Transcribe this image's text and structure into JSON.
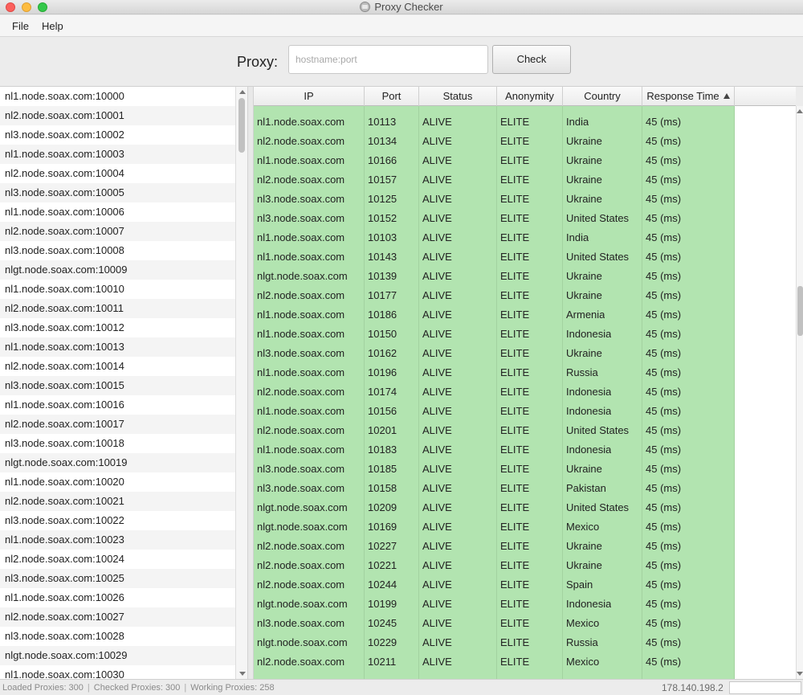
{
  "window": {
    "title": "Proxy Checker"
  },
  "menu": {
    "file": "File",
    "help": "Help"
  },
  "proxy_bar": {
    "label": "Proxy:",
    "placeholder": "hostname:port",
    "check_label": "Check"
  },
  "proxy_list": [
    "nl1.node.soax.com:10000",
    "nl2.node.soax.com:10001",
    "nl3.node.soax.com:10002",
    "nl1.node.soax.com:10003",
    "nl2.node.soax.com:10004",
    "nl3.node.soax.com:10005",
    "nl1.node.soax.com:10006",
    "nl2.node.soax.com:10007",
    "nl3.node.soax.com:10008",
    "nlgt.node.soax.com:10009",
    "nl1.node.soax.com:10010",
    "nl2.node.soax.com:10011",
    "nl3.node.soax.com:10012",
    "nl1.node.soax.com:10013",
    "nl2.node.soax.com:10014",
    "nl3.node.soax.com:10015",
    "nl1.node.soax.com:10016",
    "nl2.node.soax.com:10017",
    "nl3.node.soax.com:10018",
    "nlgt.node.soax.com:10019",
    "nl1.node.soax.com:10020",
    "nl2.node.soax.com:10021",
    "nl3.node.soax.com:10022",
    "nl1.node.soax.com:10023",
    "nl2.node.soax.com:10024",
    "nl3.node.soax.com:10025",
    "nl1.node.soax.com:10026",
    "nl2.node.soax.com:10027",
    "nl3.node.soax.com:10028",
    "nlgt.node.soax.com:10029",
    "nl1.node.soax.com:10030"
  ],
  "table": {
    "columns": [
      "IP",
      "Port",
      "Status",
      "Anonymity",
      "Country",
      "Response Time"
    ],
    "sorted_column": "Response Time",
    "row_color": "#b2e4b0",
    "rows": [
      [
        "nl1.node.soax.com",
        "10113",
        "ALIVE",
        "ELITE",
        "India",
        "45 (ms)"
      ],
      [
        "nl2.node.soax.com",
        "10134",
        "ALIVE",
        "ELITE",
        "Ukraine",
        "45 (ms)"
      ],
      [
        "nl1.node.soax.com",
        "10166",
        "ALIVE",
        "ELITE",
        "Ukraine",
        "45 (ms)"
      ],
      [
        "nl2.node.soax.com",
        "10157",
        "ALIVE",
        "ELITE",
        "Ukraine",
        "45 (ms)"
      ],
      [
        "nl3.node.soax.com",
        "10125",
        "ALIVE",
        "ELITE",
        "Ukraine",
        "45 (ms)"
      ],
      [
        "nl3.node.soax.com",
        "10152",
        "ALIVE",
        "ELITE",
        "United States",
        "45 (ms)"
      ],
      [
        "nl1.node.soax.com",
        "10103",
        "ALIVE",
        "ELITE",
        "India",
        "45 (ms)"
      ],
      [
        "nl1.node.soax.com",
        "10143",
        "ALIVE",
        "ELITE",
        "United States",
        "45 (ms)"
      ],
      [
        "nlgt.node.soax.com",
        "10139",
        "ALIVE",
        "ELITE",
        "Ukraine",
        "45 (ms)"
      ],
      [
        "nl2.node.soax.com",
        "10177",
        "ALIVE",
        "ELITE",
        "Ukraine",
        "45 (ms)"
      ],
      [
        "nl1.node.soax.com",
        "10186",
        "ALIVE",
        "ELITE",
        "Armenia",
        "45 (ms)"
      ],
      [
        "nl1.node.soax.com",
        "10150",
        "ALIVE",
        "ELITE",
        "Indonesia",
        "45 (ms)"
      ],
      [
        "nl3.node.soax.com",
        "10162",
        "ALIVE",
        "ELITE",
        "Ukraine",
        "45 (ms)"
      ],
      [
        "nl1.node.soax.com",
        "10196",
        "ALIVE",
        "ELITE",
        "Russia",
        "45 (ms)"
      ],
      [
        "nl2.node.soax.com",
        "10174",
        "ALIVE",
        "ELITE",
        "Indonesia",
        "45 (ms)"
      ],
      [
        "nl1.node.soax.com",
        "10156",
        "ALIVE",
        "ELITE",
        "Indonesia",
        "45 (ms)"
      ],
      [
        "nl2.node.soax.com",
        "10201",
        "ALIVE",
        "ELITE",
        "United States",
        "45 (ms)"
      ],
      [
        "nl1.node.soax.com",
        "10183",
        "ALIVE",
        "ELITE",
        "Indonesia",
        "45 (ms)"
      ],
      [
        "nl3.node.soax.com",
        "10185",
        "ALIVE",
        "ELITE",
        "Ukraine",
        "45 (ms)"
      ],
      [
        "nl3.node.soax.com",
        "10158",
        "ALIVE",
        "ELITE",
        "Pakistan",
        "45 (ms)"
      ],
      [
        "nlgt.node.soax.com",
        "10209",
        "ALIVE",
        "ELITE",
        "United States",
        "45 (ms)"
      ],
      [
        "nlgt.node.soax.com",
        "10169",
        "ALIVE",
        "ELITE",
        "Mexico",
        "45 (ms)"
      ],
      [
        "nl2.node.soax.com",
        "10227",
        "ALIVE",
        "ELITE",
        "Ukraine",
        "45 (ms)"
      ],
      [
        "nl2.node.soax.com",
        "10221",
        "ALIVE",
        "ELITE",
        "Ukraine",
        "45 (ms)"
      ],
      [
        "nl2.node.soax.com",
        "10244",
        "ALIVE",
        "ELITE",
        "Spain",
        "45 (ms)"
      ],
      [
        "nlgt.node.soax.com",
        "10199",
        "ALIVE",
        "ELITE",
        "Indonesia",
        "45 (ms)"
      ],
      [
        "nl3.node.soax.com",
        "10245",
        "ALIVE",
        "ELITE",
        "Mexico",
        "45 (ms)"
      ],
      [
        "nlgt.node.soax.com",
        "10229",
        "ALIVE",
        "ELITE",
        "Russia",
        "45 (ms)"
      ],
      [
        "nl2.node.soax.com",
        "10211",
        "ALIVE",
        "ELITE",
        "Mexico",
        "45 (ms)"
      ]
    ]
  },
  "status_bar": {
    "loaded": "Loaded Proxies: 300",
    "checked": "Checked Proxies: 300",
    "working": "Working Proxies: 258",
    "ip": "178.140.198.2"
  }
}
